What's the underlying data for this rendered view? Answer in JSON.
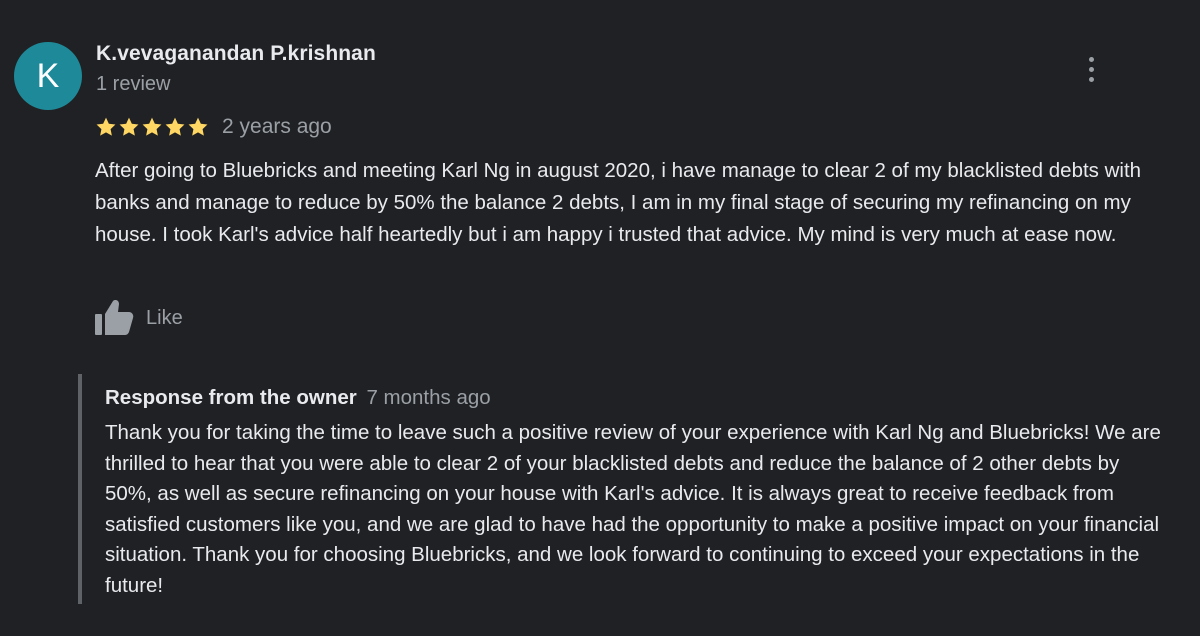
{
  "review": {
    "author": {
      "initial": "K",
      "name": "K.vevaganandan P.krishnan",
      "meta": "1 review"
    },
    "rating": {
      "stars": 5,
      "max": 5,
      "star_color": "#fdd663",
      "date": "2 years ago"
    },
    "text": "After going to Bluebricks and meeting Karl Ng in august 2020, i have manage to clear 2 of my blacklisted debts with banks and manage to reduce by 50% the balance 2 debts, I am in my final stage of securing my refinancing on my house. I took Karl's advice half heartedly but i am happy i trusted that advice. My mind is very much at ease now.",
    "like": {
      "label": "Like",
      "icon": "thumbs-up-icon"
    },
    "more_icon": "more-vert-icon"
  },
  "owner_response": {
    "title": "Response from the owner",
    "date": "7 months ago",
    "text": "Thank you for taking the time to leave such a positive review of your experience with Karl Ng and Bluebricks! We are thrilled to hear that you were able to clear 2 of your blacklisted debts and reduce the balance of 2 other debts by 50%, as well as secure refinancing on your house with Karl's advice. It is always great to receive feedback from satisfied customers like you, and we are glad to have had the opportunity to make a positive impact on your financial situation. Thank you for choosing Bluebricks, and we look forward to continuing to exceed your expectations in the future!"
  },
  "colors": {
    "background": "#202124",
    "avatar": "#1e8a99",
    "primary_text": "#e8eaed",
    "secondary_text": "#9aa0a6",
    "response_border": "#5f6368"
  }
}
